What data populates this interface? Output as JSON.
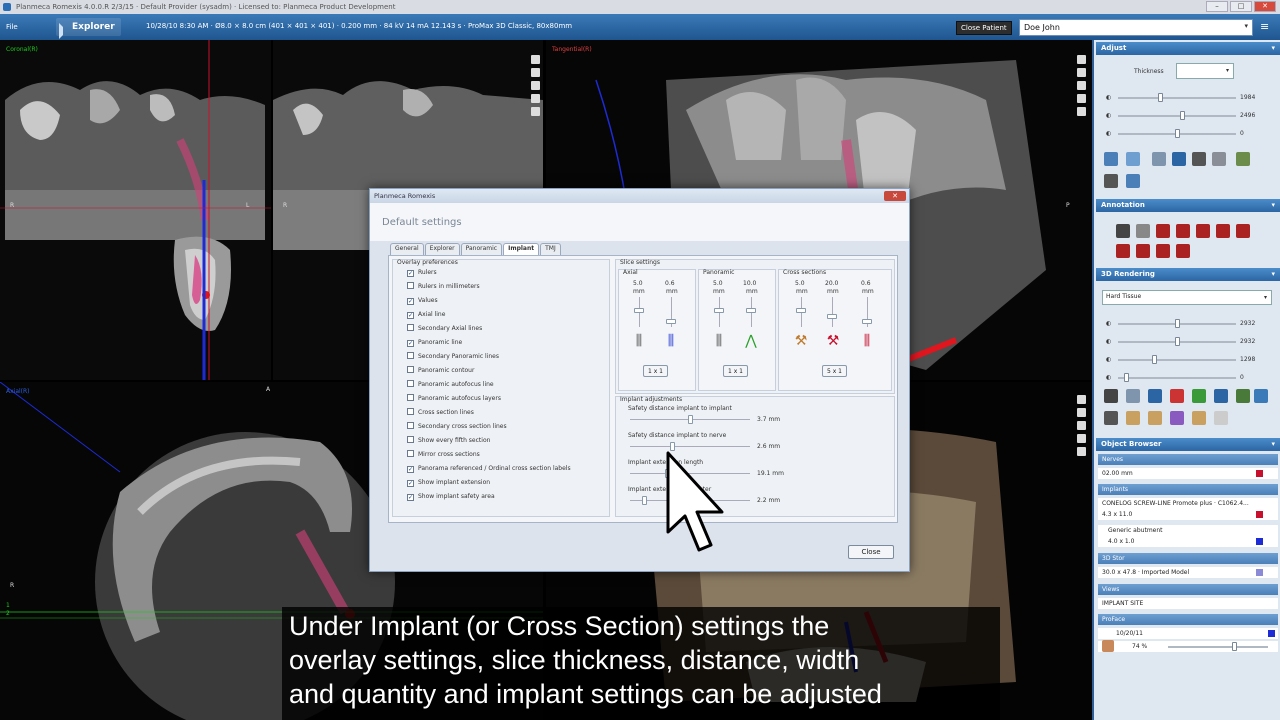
{
  "titlebar": {
    "text": "Planmeca Romexis 4.0.0.R  2/3/15  ·  Default Provider (sysadm)  ·  Licensed to: Planmeca Product Development",
    "min": "–",
    "max": "□",
    "close": "✕"
  },
  "nav": {
    "file": "File",
    "explorer": "Explorer",
    "scan_info": "10/28/10 8:30 AM  ·  Ø8.0 × 8.0 cm (401 × 401 × 401)  ·  0.200 mm  ·  84 kV 14 mA 12.143 s  ·  ProMax 3D Classic, 80x80mm",
    "close_patient": "Close Patient",
    "patient": "Doe John",
    "patient_arrow": "▾",
    "menu": "≡"
  },
  "viewer": {
    "coronal_label": "Coronal(R)",
    "tangential_label": "Tangential(R)",
    "axial_label": "Axial(R)",
    "letter_r": "R",
    "letter_l": "L",
    "letter_p": "P",
    "letter_a": "A",
    "number_1": "1",
    "number_2": "2"
  },
  "dialog": {
    "title": "Planmeca Romexis",
    "close_x": "✕",
    "header": "Default settings",
    "tabs": [
      "General",
      "Explorer",
      "Panoramic",
      "Implant",
      "TMJ"
    ],
    "active_tab": "Implant",
    "overlay": {
      "title": "Overlay preferences",
      "items": [
        {
          "label": "Rulers",
          "checked": true
        },
        {
          "label": "Rulers in millimeters",
          "checked": false
        },
        {
          "label": "Values",
          "checked": true
        },
        {
          "label": "Axial line",
          "checked": true
        },
        {
          "label": "Secondary Axial lines",
          "checked": false
        },
        {
          "label": "Panoramic line",
          "checked": true
        },
        {
          "label": "Secondary Panoramic lines",
          "checked": false
        },
        {
          "label": "Panoramic contour",
          "checked": false
        },
        {
          "label": "Panoramic autofocus line",
          "checked": false
        },
        {
          "label": "Panoramic autofocus layers",
          "checked": false
        },
        {
          "label": "Cross section lines",
          "checked": false
        },
        {
          "label": "Secondary cross section lines",
          "checked": false
        },
        {
          "label": "Show every fifth section",
          "checked": false
        },
        {
          "label": "Mirror cross sections",
          "checked": false
        },
        {
          "label": "Panorama referenced / Ordinal cross section labels",
          "checked": true
        },
        {
          "label": "Show implant extension",
          "checked": true
        },
        {
          "label": "Show implant safety area",
          "checked": true
        }
      ]
    },
    "slice": {
      "title": "Slice settings",
      "axial": {
        "title": "Axial",
        "v1": "5.0",
        "v2": "0.6",
        "u1": "mm",
        "u2": "mm",
        "btn": "1 x 1"
      },
      "panoramic": {
        "title": "Panoramic",
        "v1": "5.0",
        "v2": "10.0",
        "u1": "mm",
        "u2": "mm",
        "btn": "1 x 1"
      },
      "cross": {
        "title": "Cross sections",
        "v1": "5.0",
        "v2": "20.0",
        "v3": "0.6",
        "u1": "mm",
        "u2": "mm",
        "u3": "mm",
        "btn": "5 x 1"
      }
    },
    "implant": {
      "title": "Implant adjustments",
      "rows": [
        {
          "label": "Safety distance implant to implant",
          "value": "3.7 mm",
          "level": 0.5
        },
        {
          "label": "Safety distance implant to nerve",
          "value": "2.6 mm",
          "level": 0.35
        },
        {
          "label": "Implant extension length",
          "value": "19.1 mm",
          "level": 0.3
        },
        {
          "label": "Implant extension diameter",
          "value": "2.2 mm",
          "level": 0.1
        }
      ]
    },
    "close_btn": "Close"
  },
  "caption": [
    "Under Implant (or Cross Section) settings the",
    "overlay settings, slice thickness, distance, width",
    "and quantity and implant settings can be adjusted"
  ],
  "right": {
    "adjust": {
      "title": "Adjust",
      "pin": "▾",
      "thickness_label": "Thickness",
      "thickness_arrow": "▾",
      "sliders": [
        {
          "value": "1984",
          "level": 0.35
        },
        {
          "value": "2496",
          "level": 0.55
        },
        {
          "value": "0",
          "level": 0.5
        }
      ]
    },
    "annotation": {
      "title": "Annotation",
      "pin": "▾"
    },
    "rendering": {
      "title": "3D Rendering",
      "pin": "▾",
      "preset": "Hard Tissue",
      "preset_arrow": "▾",
      "sliders": [
        {
          "value": "2932",
          "level": 0.5
        },
        {
          "value": "2932",
          "level": 0.5
        },
        {
          "value": "1298",
          "level": 0.3
        },
        {
          "value": "0",
          "level": 0.05
        }
      ]
    },
    "object_browser": {
      "title": "Object Browser",
      "pin": "▾",
      "rows": {
        "nerves": "Nerves",
        "nerve_item": "02.00 mm",
        "implants": "Implants",
        "implant_name": "CONELOG SCREW-LINE Promote plus · C1062.4...",
        "implant_size": "4.3 x 11.0",
        "abutment": "Generic abutment",
        "abutment_size": "4.0 x 1.0",
        "surface": "3D Stor",
        "model": "30.0 x 47.8 · Imported Model",
        "views": "Views",
        "implant_site": "IMPLANT SITE",
        "profaces": "ProFace",
        "proface_date": "10/20/11",
        "opacity": "74 %"
      }
    },
    "colors": {
      "accent": "#2c65a3",
      "red": "#c8102e",
      "blue": "#1d2bd6"
    }
  }
}
